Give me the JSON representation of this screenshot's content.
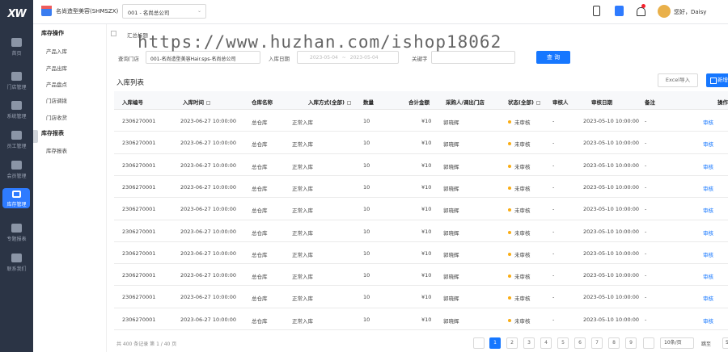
{
  "app": {
    "logo_text": "XW"
  },
  "rail": [
    {
      "label": "首页",
      "icon": "home-icon"
    },
    {
      "label": "门店管理",
      "icon": "store-icon"
    },
    {
      "label": "系统管理",
      "icon": "monitor-icon"
    },
    {
      "label": "员工管理",
      "icon": "employee-icon"
    },
    {
      "label": "会员管理",
      "icon": "member-icon"
    },
    {
      "label": "库存管理",
      "icon": "inventory-icon",
      "active": true
    },
    {
      "label": "专题报表",
      "icon": "report-icon"
    },
    {
      "label": "联系我们",
      "icon": "phone-icon"
    }
  ],
  "topbar": {
    "shop_name": "名尚造型美容(SHMSZX)",
    "company_select": "001 - 名尚总公司",
    "greeting": "您好，Daisy"
  },
  "submenu": {
    "group1": "库存操作",
    "group1_items": [
      "产品入库",
      "产品出库",
      "产品盘点",
      "门店调拨",
      "门店收货"
    ],
    "group2": "库存报表",
    "group2_items": [
      "库存报表"
    ]
  },
  "watermark": "https://www.huzhan.com/ishop18062",
  "filters": {
    "summary_checkbox_label": "汇总标题",
    "store_label": "查询门店",
    "store_value": "001-名尚造型美容Hair.sps-名尚总公司",
    "date_label": "入库日期",
    "date_start": "2023-05-04",
    "date_sep": "~",
    "date_end": "2023-05-04",
    "keyword_label": "关键字",
    "query_button": "查 询"
  },
  "list": {
    "title": "入库列表",
    "excel_button": "Excel导入",
    "add_button": "新增"
  },
  "table": {
    "columns": [
      "入库编号",
      "入库时间",
      "仓库名称",
      "入库方式(全部)",
      "数量",
      "合计金额",
      "采购人/调出门店",
      "状态(全部)",
      "审核人",
      "审核日期",
      "备注",
      "操作"
    ],
    "rows": [
      [
        "2306270001",
        "2023-06-27 10:00:00",
        "总仓库",
        "正常入库",
        "10",
        "¥10",
        "郭晓辉",
        "未审核",
        "-",
        "2023-05-10 10:00:00",
        "-",
        "审核"
      ],
      [
        "2306270001",
        "2023-06-27 10:00:00",
        "总仓库",
        "正常入库",
        "10",
        "¥10",
        "郭晓辉",
        "未审核",
        "-",
        "2023-05-10 10:00:00",
        "-",
        "审核"
      ],
      [
        "2306270001",
        "2023-06-27 10:00:00",
        "总仓库",
        "正常入库",
        "10",
        "¥10",
        "郭晓辉",
        "未审核",
        "-",
        "2023-05-10 10:00:00",
        "-",
        "审核"
      ],
      [
        "2306270001",
        "2023-06-27 10:00:00",
        "总仓库",
        "正常入库",
        "10",
        "¥10",
        "郭晓辉",
        "未审核",
        "-",
        "2023-05-10 10:00:00",
        "-",
        "审核"
      ],
      [
        "2306270001",
        "2023-06-27 10:00:00",
        "总仓库",
        "正常入库",
        "10",
        "¥10",
        "郭晓辉",
        "未审核",
        "-",
        "2023-05-10 10:00:00",
        "-",
        "审核"
      ],
      [
        "2306270001",
        "2023-06-27 10:00:00",
        "总仓库",
        "正常入库",
        "10",
        "¥10",
        "郭晓辉",
        "未审核",
        "-",
        "2023-05-10 10:00:00",
        "-",
        "审核"
      ],
      [
        "2306270001",
        "2023-06-27 10:00:00",
        "总仓库",
        "正常入库",
        "10",
        "¥10",
        "郭晓辉",
        "未审核",
        "-",
        "2023-05-10 10:00:00",
        "-",
        "审核"
      ],
      [
        "2306270001",
        "2023-06-27 10:00:00",
        "总仓库",
        "正常入库",
        "10",
        "¥10",
        "郭晓辉",
        "未审核",
        "-",
        "2023-05-10 10:00:00",
        "-",
        "审核"
      ],
      [
        "2306270001",
        "2023-06-27 10:00:00",
        "总仓库",
        "正常入库",
        "10",
        "¥10",
        "郭晓辉",
        "未审核",
        "-",
        "2023-05-10 10:00:00",
        "-",
        "审核"
      ],
      [
        "2306270001",
        "2023-06-27 10:00:00",
        "总仓库",
        "正常入库",
        "10",
        "¥10",
        "郭晓辉",
        "未审核",
        "-",
        "2023-05-10 10:00:00",
        "-",
        "审核"
      ]
    ]
  },
  "pagination": {
    "info": "共 400 条记录 第 1 / 40 页",
    "pages": [
      "1",
      "2",
      "3",
      "4",
      "5",
      "6",
      "7",
      "8",
      "9"
    ],
    "current": "1",
    "page_size": "10条/页",
    "goto_label": "跳至",
    "goto_value": "5"
  },
  "colors": {
    "primary": "#1677ff",
    "rail_bg": "#2b3445",
    "status_pending": "#faad14"
  }
}
